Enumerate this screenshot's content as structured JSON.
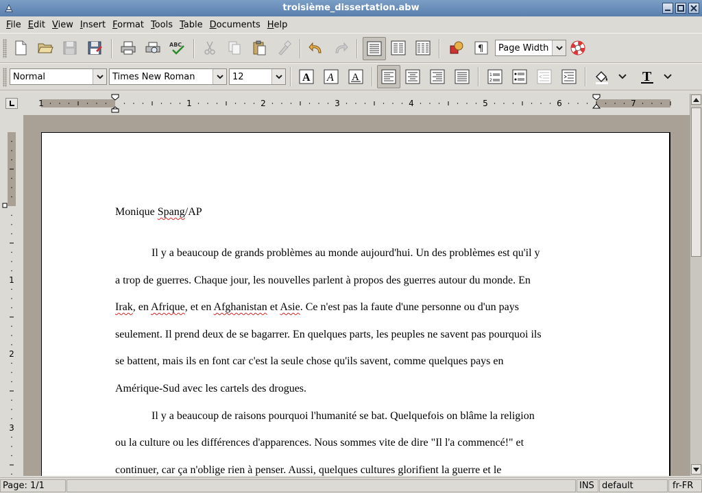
{
  "window": {
    "title": "troisième_dissertation.abw"
  },
  "menu": [
    {
      "label": "File",
      "name": "menu-file"
    },
    {
      "label": "Edit",
      "name": "menu-edit"
    },
    {
      "label": "View",
      "name": "menu-view"
    },
    {
      "label": "Insert",
      "name": "menu-insert"
    },
    {
      "label": "Format",
      "name": "menu-format"
    },
    {
      "label": "Tools",
      "name": "menu-tools"
    },
    {
      "label": "Table",
      "name": "menu-table"
    },
    {
      "label": "Documents",
      "name": "menu-documents"
    },
    {
      "label": "Help",
      "name": "menu-help"
    }
  ],
  "toolbar": {
    "zoom": "Page Width"
  },
  "format_bar": {
    "style": "Normal",
    "font": "Times New Roman",
    "size": "12"
  },
  "ruler": {
    "h_labels": [
      "1",
      "1",
      "2",
      "3",
      "4",
      "5",
      "6",
      "7"
    ],
    "v_labels": [
      "1",
      "2",
      "3"
    ]
  },
  "document": {
    "author": {
      "pre": "Monique ",
      "misspelled": "Spang",
      "post": "/AP"
    },
    "lines": {
      "l1": "Il y a beaucoup de grands problèmes au monde aujourd'hui. Un des problèmes est qu'il y",
      "l2": "a trop de guerres. Chaque jour, les nouvelles parlent à propos des guerres autour du monde. En",
      "l3_w1": "Irak",
      "l3_t1": ", en ",
      "l3_w2": "Afrique",
      "l3_t2": ", et en ",
      "l3_w3": "Afghanistan",
      "l3_t3": " et ",
      "l3_w4": "Asie",
      "l3_t4": ". Ce n'est pas la faute d'une personne ou d'un pays",
      "l4": "seulement. Il prend deux de se bagarrer. En quelques parts, les peuples ne savent pas pourquoi ils",
      "l5": "se battent, mais ils en font car c'est la seule chose qu'ils savent, comme quelques pays en",
      "l6": "Amérique-Sud avec les cartels des drogues.",
      "l7": "Il y a beaucoup de raisons pourquoi l'humanité se bat. Quelquefois on blâme la religion",
      "l8": "ou la culture ou les différences d'apparences. Nous sommes vite de dire \"Il l'a commencé!\" et",
      "l9": "continuer, car ça n'oblige rien à penser. Aussi, quelques cultures glorifient la guerre et le"
    }
  },
  "status": {
    "page": "Page: 1/1",
    "mode": "INS",
    "style": "default",
    "lang": "fr-FR"
  }
}
